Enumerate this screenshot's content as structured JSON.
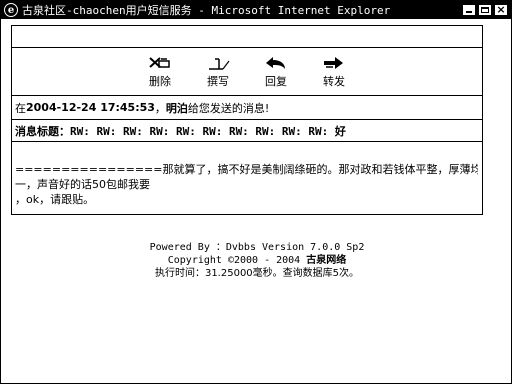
{
  "window": {
    "title": "古泉社区-chaochen用户短信服务 - Microsoft Internet Explorer",
    "icon": "ie-icon",
    "controls": [
      "minimize-icon",
      "maximize-icon",
      "close-icon"
    ]
  },
  "toolbar": {
    "delete_label": "删除",
    "compose_label": "撰写",
    "reply_label": "回复",
    "forward_label": "转发"
  },
  "message": {
    "prefix": "在",
    "datetime": "2004-12-24 17:45:53",
    "comma": "，",
    "sender": "明泊",
    "suffix": "给您发送的消息!",
    "subject_label": "消息标题：",
    "subject_value": "RW: RW: RW: RW: RW: RW: RW: RW: RW: RW: 好",
    "body_lines": [
      "================那就算了，搞不好是美制阔绦砸的。那对政和若钱体平整，厚薄均",
      "一，声音好的话50包邮我要",
      "，ok，请跟贴。"
    ]
  },
  "footer": {
    "powered": "Powered By ：Dvbbs Version 7.0.0 Sp2",
    "copyright_prefix": "Copyright ©2000 - 2004 ",
    "copyright_site": "古泉网络",
    "exec": "执行时间：31.25000毫秒。查询数据库5次。"
  }
}
